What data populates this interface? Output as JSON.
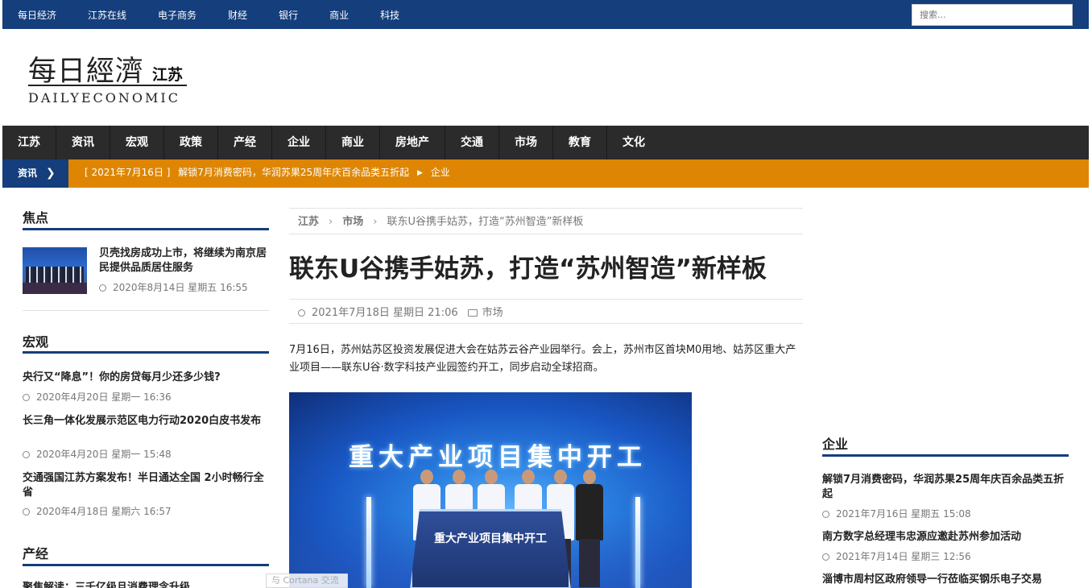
{
  "topnav": {
    "items": [
      "每日经济",
      "江苏在线",
      "电子商务",
      "财经",
      "银行",
      "商业",
      "科技"
    ],
    "search_placeholder": "搜索..."
  },
  "logo": {
    "cn": "每日經濟",
    "sub": "江苏",
    "en": "DAILYECONOMIC"
  },
  "mainnav": {
    "items": [
      "江苏",
      "资讯",
      "宏观",
      "政策",
      "产经",
      "企业",
      "商业",
      "房地产",
      "交通",
      "市场",
      "教育",
      "文化"
    ]
  },
  "ticker": {
    "label": "资讯",
    "date": "[ 2021年7月16日 ]",
    "headline": "解锁7月消费密码，华润苏果25周年庆百余品类五折起",
    "category": "企业"
  },
  "left": {
    "focus": {
      "title": "焦点",
      "item": {
        "title": "贝壳找房成功上市，将继续为南京居民提供品质居住服务",
        "date": "2020年8月14日 星期五 16:55"
      }
    },
    "macro": {
      "title": "宏观",
      "items": [
        {
          "title": "央行又“降息”！你的房贷每月少还多少钱?",
          "date": "2020年4月20日 星期一 16:36"
        },
        {
          "title": "长三角一体化发展示范区电力行动2020白皮书发布",
          "date": "2020年4月20日 星期一 15:48"
        },
        {
          "title": "交通强国江苏方案发布！半日通达全国 2小时畅行全省",
          "date": "2020年4月18日 星期六 16:57"
        }
      ]
    },
    "industry": {
      "title": "产经",
      "partial": "聚焦解读：三千亿级且消费理念升级"
    }
  },
  "article": {
    "breadcrumb": [
      "江苏",
      "市场",
      "联东U谷携手姑苏，打造“苏州智造”新样板"
    ],
    "title": "联东U谷携手姑苏，打造“苏州智造”新样板",
    "date": "2021年7月18日 星期日 21:06",
    "category": "市场",
    "lead": "7月16日，苏州姑苏区投资发展促进大会在姑苏云谷产业园举行。会上，苏州市区首块M0用地、姑苏区重大产业项目——联东U谷·数字科技产业园签约开工，同步启动全球招商。",
    "image_text": "重大产业项目集中开工",
    "podium_text": "重大产业项目集中开工"
  },
  "right": {
    "enterprise": {
      "title": "企业",
      "items": [
        {
          "title": "解锁7月消费密码，华润苏果25周年庆百余品类五折起",
          "date": "2021年7月16日 星期五 15:08"
        },
        {
          "title": "南方数字总经理韦忠源应邀赴苏州参加活动",
          "date": "2021年7月14日 星期三 12:56"
        },
        {
          "title": "淄博市周村区政府领导一行莅临买钢乐电子交易",
          "date": ""
        }
      ]
    }
  },
  "overlay": {
    "cortana": "与 Cortana 交流"
  },
  "colors": {
    "brand_blue": "#143e7c",
    "nav_dark": "#2b2b2b",
    "ticker_orange": "#de8603"
  }
}
